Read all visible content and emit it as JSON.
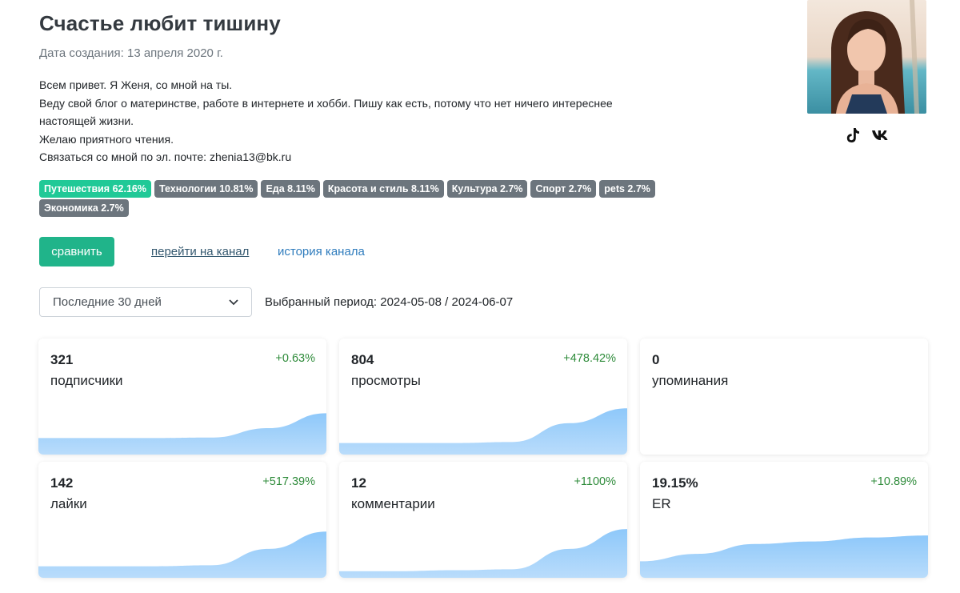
{
  "title": "Счастье любит тишину",
  "created": "Дата создания: 13 апреля 2020 г.",
  "about": [
    "Всем привет. Я Женя, со мной на ты.",
    "Веду свой блог о материнстве, работе в интернете и хобби. Пишу как есть, потому что нет ничего интереснее",
    "настоящей жизни.",
    "Желаю приятного чтения.",
    "Связаться со мной по эл. почте: zhenia13@bk.ru"
  ],
  "social": {
    "tiktok": "tiktok-icon",
    "vk": "vk-icon"
  },
  "tags": [
    {
      "label": "Путешествия 62.16%",
      "color": "#20c997"
    },
    {
      "label": "Технологии 10.81%",
      "color": "#6c757d"
    },
    {
      "label": "Еда 8.11%",
      "color": "#6c757d"
    },
    {
      "label": "Красота и стиль 8.11%",
      "color": "#6c757d"
    },
    {
      "label": "Культура 2.7%",
      "color": "#6c757d"
    },
    {
      "label": "Спорт 2.7%",
      "color": "#6c757d"
    },
    {
      "label": "pets 2.7%",
      "color": "#6c757d"
    },
    {
      "label": "Экономика 2.7%",
      "color": "#6c757d"
    }
  ],
  "actions": {
    "compare": "сравнить",
    "go_channel": "перейти на канал",
    "history": "история канала"
  },
  "period": {
    "selected": "Последние 30 дней",
    "text": "Выбранный период: 2024-05-08 / 2024-06-07"
  },
  "stats": [
    {
      "value": "321",
      "label": "подписчики",
      "delta": "+0.63%",
      "trend": [
        0.3,
        0.3,
        0.3,
        0.31,
        0.5,
        0.8
      ]
    },
    {
      "value": "804",
      "label": "просмотры",
      "delta": "+478.42%",
      "trend": [
        0.2,
        0.2,
        0.2,
        0.22,
        0.6,
        0.9
      ]
    },
    {
      "value": "0",
      "label": "упоминания",
      "delta": "",
      "trend": []
    },
    {
      "value": "142",
      "label": "лайки",
      "delta": "+517.39%",
      "trend": [
        0.2,
        0.2,
        0.2,
        0.22,
        0.55,
        0.9
      ]
    },
    {
      "value": "12",
      "label": "комментарии",
      "delta": "+1100%",
      "trend": [
        0.1,
        0.1,
        0.12,
        0.14,
        0.55,
        0.95
      ]
    },
    {
      "value": "19.15%",
      "label": "ER",
      "delta": "+10.89%",
      "trend": [
        0.3,
        0.45,
        0.65,
        0.7,
        0.78,
        0.82
      ]
    }
  ],
  "colors": {
    "accent": "#20b48a",
    "positive": "#2e8b3a",
    "link": "#2f7cbd",
    "spark": "#b9dcfb"
  }
}
